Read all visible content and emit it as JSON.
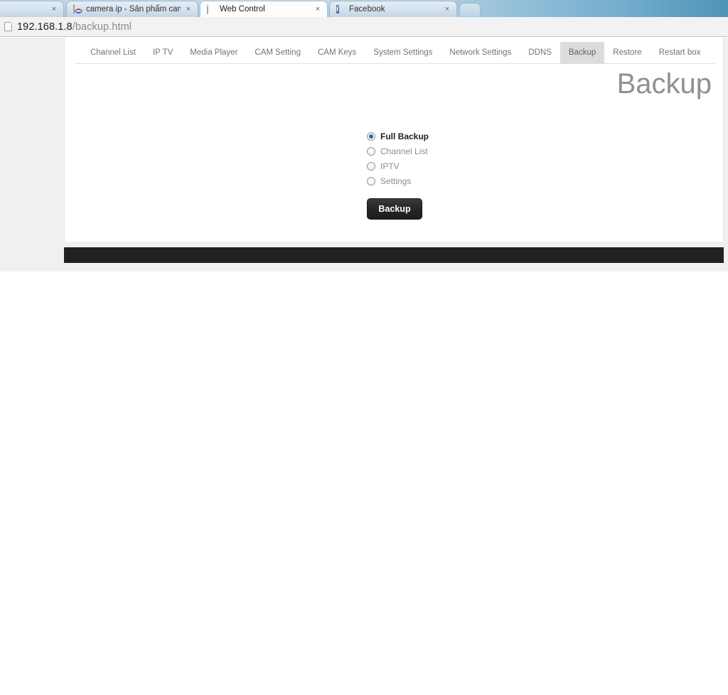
{
  "browser": {
    "tabs": [
      {
        "title": "",
        "favicon": "none-icon",
        "close_label": "×",
        "active": false
      },
      {
        "title": "camera ip - Sản phẩm cam",
        "favicon": "camera-icon",
        "close_label": "×",
        "active": false
      },
      {
        "title": "Web Control",
        "favicon": "page-icon",
        "close_label": "×",
        "active": true
      },
      {
        "title": "Facebook",
        "favicon": "facebook-icon",
        "close_label": "×",
        "active": false
      }
    ],
    "new_tab_label": "",
    "address_bar": {
      "icon": "page-icon",
      "host": "192.168.1.8",
      "path": "/backup.html"
    }
  },
  "page": {
    "nav": [
      {
        "label": "Channel List",
        "active": false
      },
      {
        "label": "IP TV",
        "active": false
      },
      {
        "label": "Media Player",
        "active": false
      },
      {
        "label": "CAM Setting",
        "active": false
      },
      {
        "label": "CAM Keys",
        "active": false
      },
      {
        "label": "System Settings",
        "active": false
      },
      {
        "label": "Network Settings",
        "active": false
      },
      {
        "label": "DDNS",
        "active": false
      },
      {
        "label": "Backup",
        "active": true
      },
      {
        "label": "Restore",
        "active": false
      },
      {
        "label": "Restart box",
        "active": false
      }
    ],
    "title": "Backup",
    "options": [
      {
        "label": "Full Backup",
        "checked": true
      },
      {
        "label": "Channel List",
        "checked": false
      },
      {
        "label": "IPTV",
        "checked": false
      },
      {
        "label": "Settings",
        "checked": false
      }
    ],
    "submit_label": "Backup"
  },
  "colors": {
    "accent_radio": "#2b6bb5",
    "title_gray": "#8d9196",
    "active_tab_bg": "#dcdcdc",
    "footer": "#212121"
  }
}
